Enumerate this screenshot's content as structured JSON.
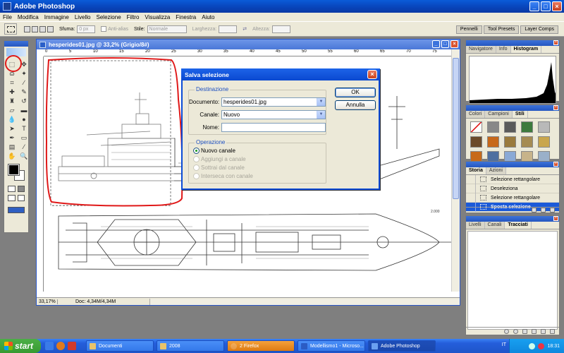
{
  "app": {
    "title": "Adobe Photoshop"
  },
  "menu": [
    "File",
    "Modifica",
    "Immagine",
    "Livello",
    "Selezione",
    "Filtro",
    "Visualizza",
    "Finestra",
    "Aiuto"
  ],
  "options": {
    "sfumatura_label": "Sfuma:",
    "sfumatura_value": "0 px",
    "antialias_label": "Anti-alias",
    "stile_label": "Stile:",
    "stile_value": "Normale",
    "larghezza_label": "Larghezza:",
    "altezza_label": "Altezza:",
    "wells": [
      "Pennelli",
      "Tool Presets",
      "Layer Comps"
    ]
  },
  "document": {
    "title": "hesperides01.jpg @ 33,2% (Grigio/8#)",
    "zoom": "33,17%",
    "doc_info": "Doc: 4,34M/4,34M",
    "ruler_labels": [
      "0",
      "5",
      "10",
      "15",
      "20",
      "25",
      "30",
      "35",
      "40",
      "45",
      "50",
      "55",
      "60",
      "65",
      "70",
      "75"
    ]
  },
  "dialog": {
    "title": "Salva selezione",
    "dest_group": "Destinazione",
    "documento_label": "Documento:",
    "documento_value": "hesperides01.jpg",
    "canale_label": "Canale:",
    "canale_value": "Nuovo",
    "nome_label": "Nome:",
    "nome_value": "",
    "op_group": "Operazione",
    "ops": [
      "Nuovo canale",
      "Aggiungi a canale",
      "Sottrai dal canale",
      "Interseca con canale"
    ],
    "ok": "OK",
    "annulla": "Annulla"
  },
  "panels": {
    "nav_tabs": [
      "Navigatore",
      "Info",
      "Histogram"
    ],
    "style_tabs": [
      "Colori",
      "Campioni",
      "Stili"
    ],
    "history_tabs": [
      "Storia",
      "Azioni"
    ],
    "history_items": [
      "Selezione rettangolare",
      "Deseleziona",
      "Selezione rettangolare",
      "Sposta selezione"
    ],
    "layer_tabs": [
      "Livelli",
      "Canali",
      "Tracciati"
    ]
  },
  "taskbar": {
    "start": "start",
    "tasks": [
      "Documenti",
      "2008",
      "2 Firefox",
      "Modellismo1 - Microso...",
      "Adobe Photoshop"
    ],
    "lang": "IT",
    "clock": "18:31"
  },
  "colors": {
    "selection_highlight": "#e01818",
    "xp_blue": "#0a48d0"
  }
}
